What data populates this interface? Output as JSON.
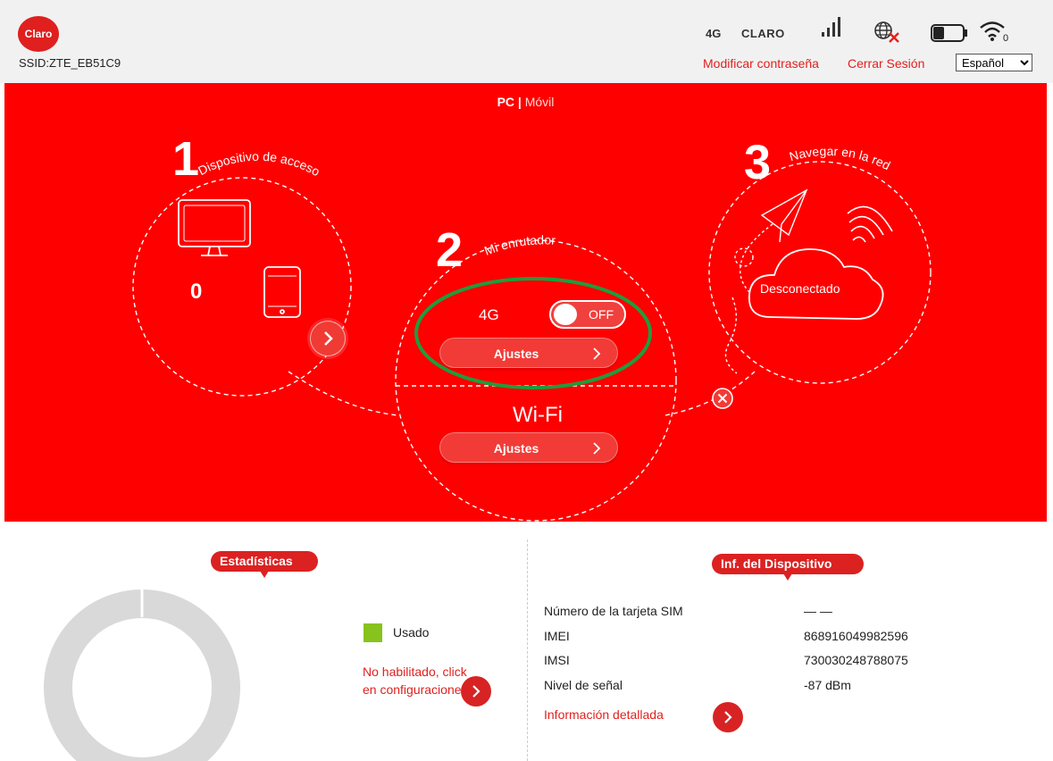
{
  "header": {
    "logo_text": "Claro",
    "ssid": "SSID:ZTE_EB51C9",
    "network_type": "4G",
    "carrier": "CLARO",
    "signal_icon": "signal-bars-icon",
    "globe_icon": "globe-disconnected-icon",
    "battery_icon": "battery-icon",
    "wifi_icon": "wifi-icon",
    "wifi_clients": "0",
    "change_password": "Modificar contraseña",
    "logout": "Cerrar Sesión",
    "language": "Español",
    "language_options": [
      "Español"
    ]
  },
  "hero": {
    "mode_pc": "PC",
    "mode_separator": "|",
    "mode_mobile": "Móvil",
    "step1_number": "1",
    "step1_title": "Dispositivo de acceso",
    "device_count": "0",
    "step2_number": "2",
    "step2_title": "Mi enrutador",
    "lte_label": "4G",
    "lte_toggle": "OFF",
    "lte_settings": "Ajustes",
    "wifi_label": "Wi-Fi",
    "wifi_settings": "Ajustes",
    "step3_number": "3",
    "step3_title": "Navegar en la red",
    "connection_status": "Desconectado"
  },
  "stats": {
    "title": "Estadísticas",
    "legend_used": "Usado",
    "not_enabled": "No habilitado, click en configuraciones",
    "used_fraction": 0
  },
  "device_info": {
    "title": "Inf. del Dispositivo",
    "rows": [
      {
        "label": "Número de la tarjeta SIM",
        "value": "— —"
      },
      {
        "label": "IMEI",
        "value": "868916049982596"
      },
      {
        "label": "IMSI",
        "value": "730030248788075"
      },
      {
        "label": "Nivel de señal",
        "value": "-87 dBm"
      }
    ],
    "details_link": "Información detallada"
  },
  "colors": {
    "brand_red": "#fe0000",
    "link_red": "#e0211e",
    "tag_red": "#dc2121",
    "used_green": "#87c31c",
    "highlight_green": "#1e9d3c"
  }
}
